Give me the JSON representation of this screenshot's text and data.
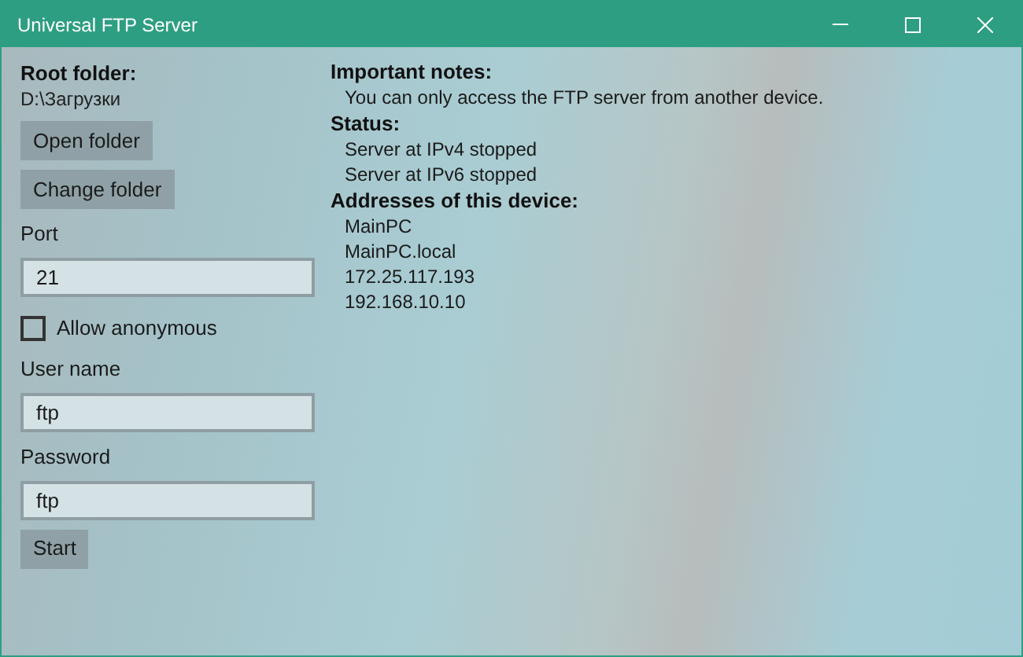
{
  "window": {
    "title": "Universal FTP Server"
  },
  "root_folder": {
    "label": "Root folder:",
    "path": "D:\\Загрузки"
  },
  "folder_buttons": [
    "Open folder",
    "Change folder"
  ],
  "port": {
    "label": "Port",
    "value": "21"
  },
  "allow_anonymous": {
    "label": "Allow anonymous",
    "checked": false
  },
  "user_name": {
    "label": "User name",
    "value": "ftp"
  },
  "password": {
    "label": "Password",
    "value": "ftp"
  },
  "start_button": "Start",
  "sections": [
    {
      "heading": "Important notes:",
      "lines": [
        "You can only access the FTP server from another device."
      ]
    },
    {
      "heading": "Status:",
      "lines": [
        "Server at IPv4 stopped",
        "Server at IPv6 stopped"
      ]
    },
    {
      "heading": "Addresses of this device:",
      "lines": [
        "MainPC",
        "MainPC.local",
        "172.25.117.193",
        "192.168.10.10"
      ]
    }
  ]
}
